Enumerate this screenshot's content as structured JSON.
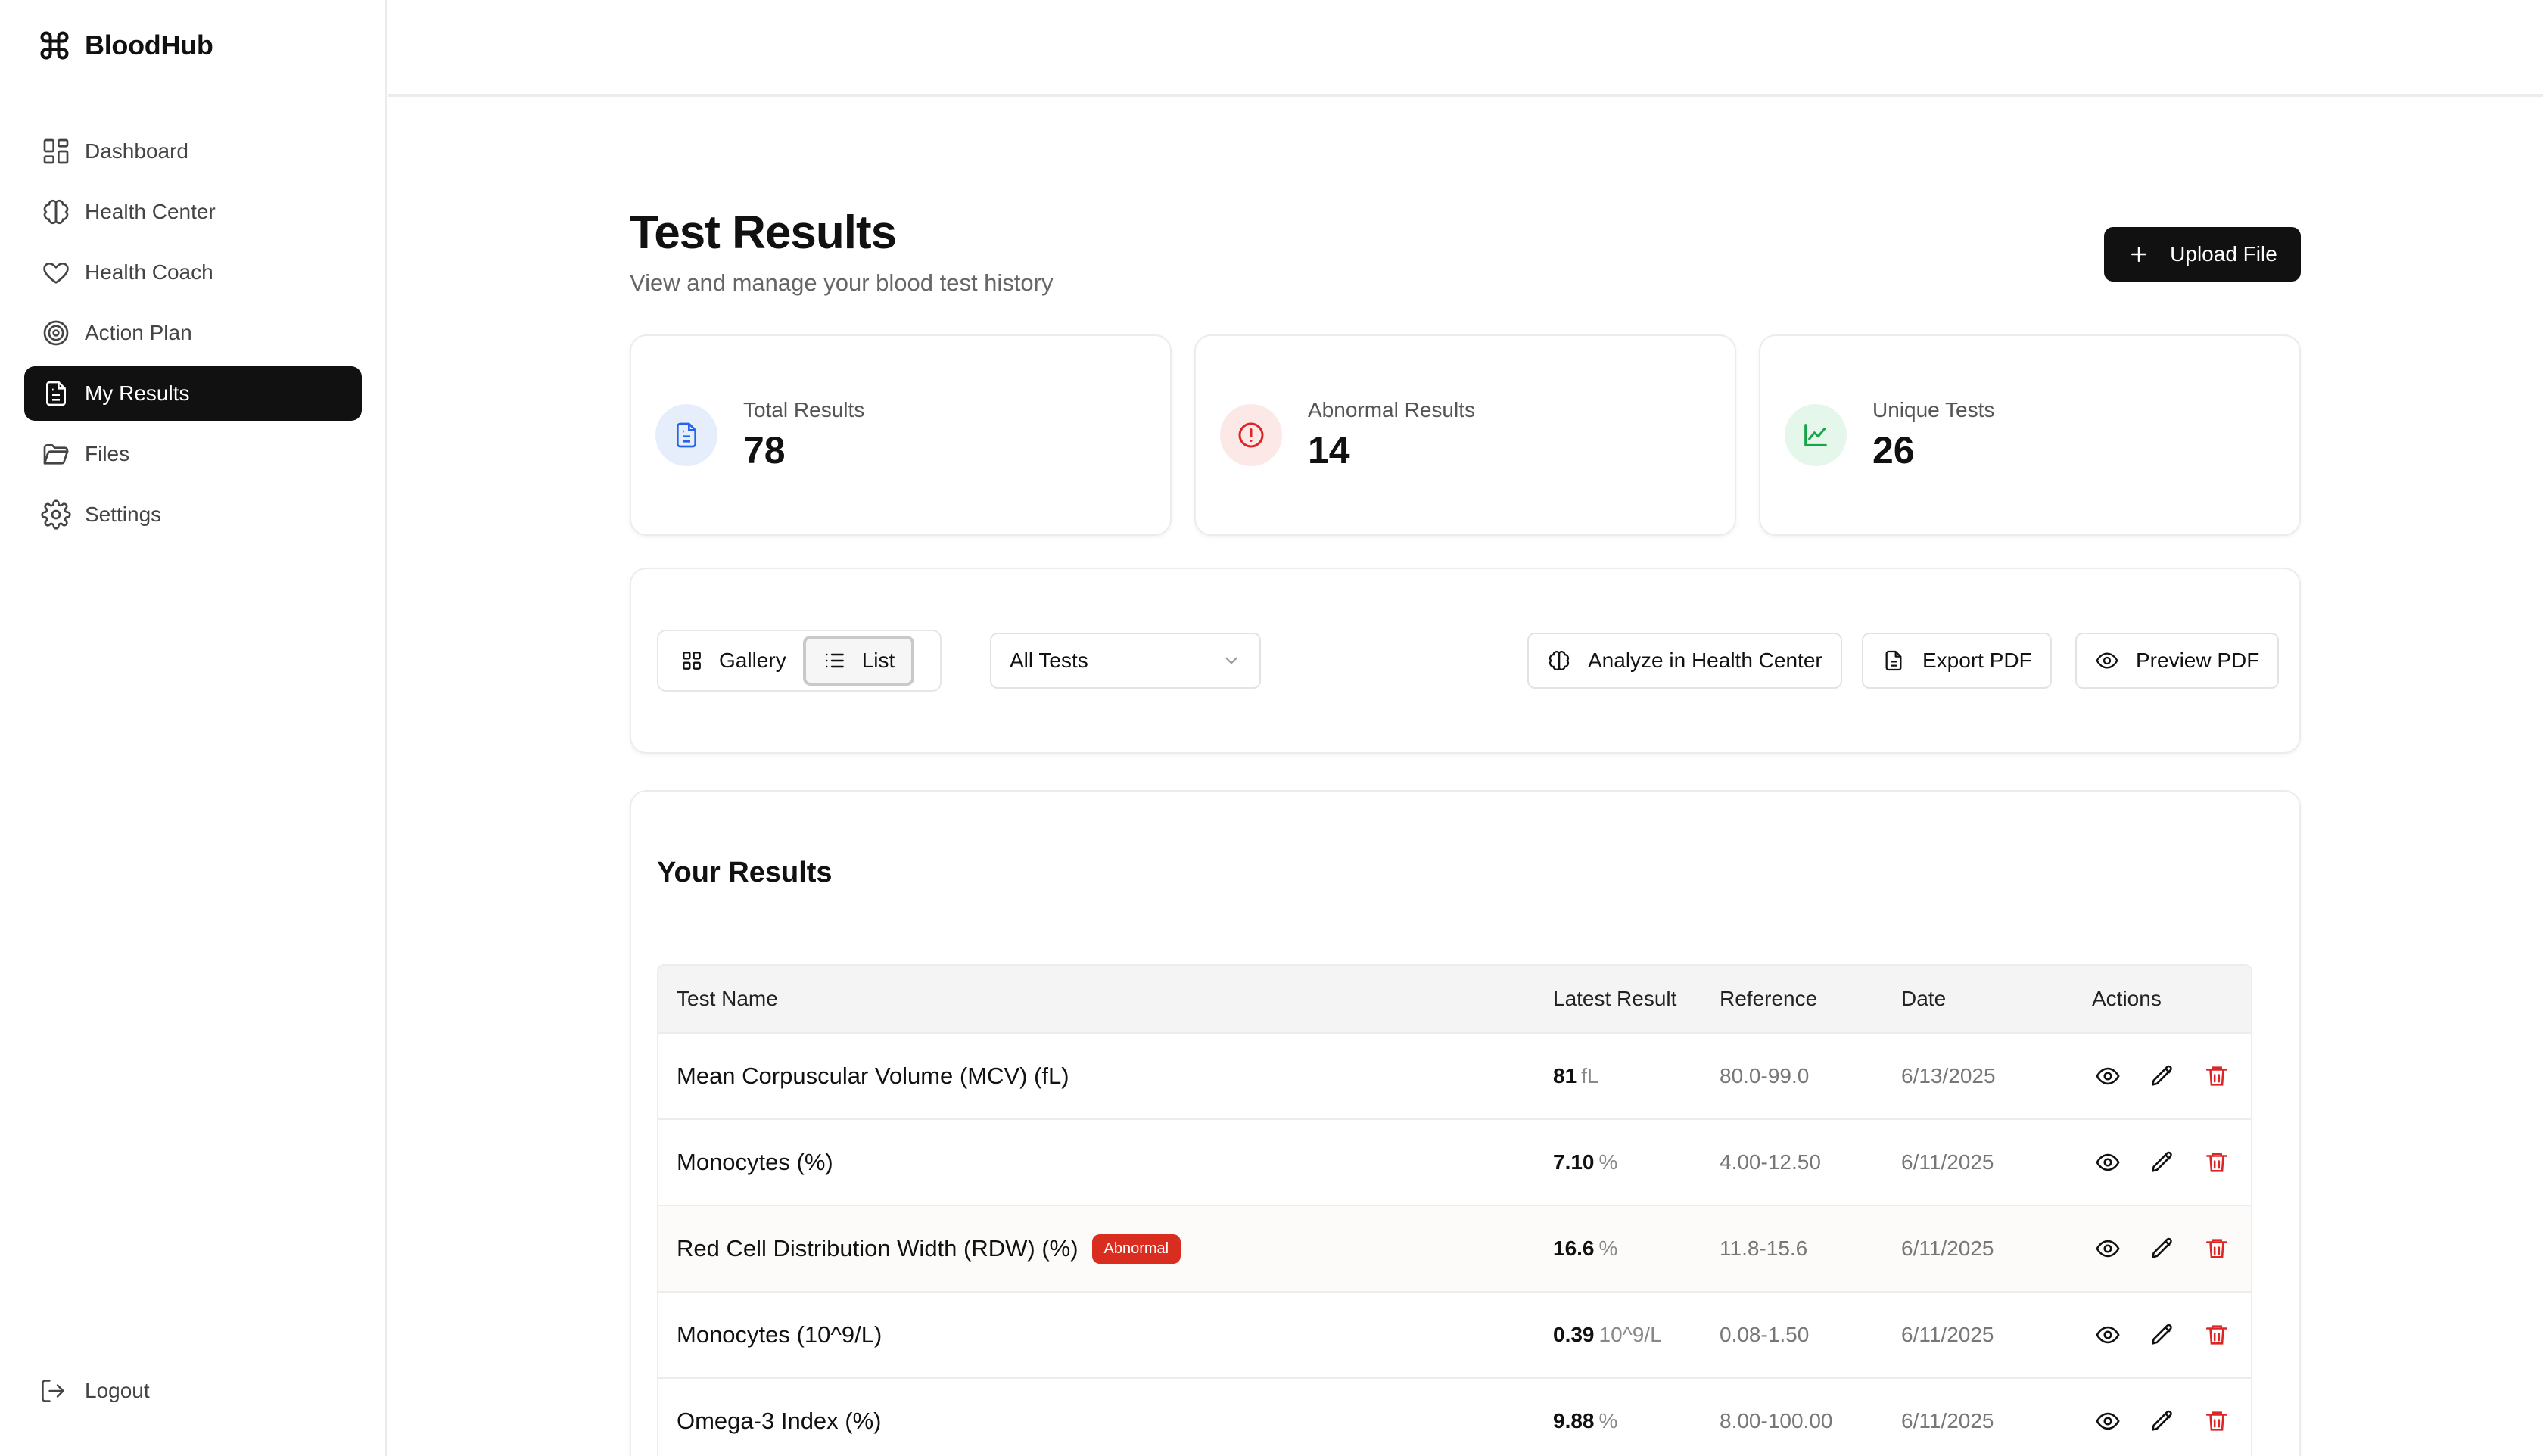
{
  "app": {
    "name": "BloodHub"
  },
  "sidebar": {
    "items": [
      {
        "label": "Dashboard",
        "icon": "grid-icon"
      },
      {
        "label": "Health Center",
        "icon": "brain-icon"
      },
      {
        "label": "Health Coach",
        "icon": "heart-icon"
      },
      {
        "label": "Action Plan",
        "icon": "target-icon"
      },
      {
        "label": "My Results",
        "icon": "document-icon",
        "active": true
      },
      {
        "label": "Files",
        "icon": "folder-icon"
      },
      {
        "label": "Settings",
        "icon": "gear-icon"
      }
    ],
    "logout": "Logout"
  },
  "header": {
    "title": "Test Results",
    "subtitle": "View and manage your blood test history",
    "upload_label": "Upload File"
  },
  "stats": [
    {
      "label": "Total Results",
      "value": "78",
      "color": "#2563eb",
      "bg": "#e6eefc"
    },
    {
      "label": "Abnormal Results",
      "value": "14",
      "color": "#dc2626",
      "bg": "#fde8e8"
    },
    {
      "label": "Unique Tests",
      "value": "26",
      "color": "#16a34a",
      "bg": "#e5f6ea"
    }
  ],
  "toolbar": {
    "gallery_label": "Gallery",
    "list_label": "List",
    "filter_selected": "All Tests",
    "analyze_label": "Analyze in Health Center",
    "export_label": "Export PDF",
    "preview_label": "Preview PDF"
  },
  "results": {
    "title": "Your Results",
    "columns": [
      "Test Name",
      "Latest Result",
      "Reference",
      "Date",
      "Actions"
    ],
    "rows": [
      {
        "name": "Mean Corpuscular Volume (MCV) (fL)",
        "value": "81",
        "unit": "fL",
        "reference": "80.0-99.0",
        "date": "6/13/2025",
        "badge": ""
      },
      {
        "name": "Monocytes (%)",
        "value": "7.10",
        "unit": "%",
        "reference": "4.00-12.50",
        "date": "6/11/2025",
        "badge": ""
      },
      {
        "name": "Red Cell Distribution Width (RDW) (%)",
        "value": "16.6",
        "unit": "%",
        "reference": "11.8-15.6",
        "date": "6/11/2025",
        "badge": "Abnormal"
      },
      {
        "name": "Monocytes (10^9/L)",
        "value": "0.39",
        "unit": "10^9/L",
        "reference": "0.08-1.50",
        "date": "6/11/2025",
        "badge": ""
      },
      {
        "name": "Omega-3 Index (%)",
        "value": "9.88",
        "unit": "%",
        "reference": "8.00-100.00",
        "date": "6/11/2025",
        "badge": ""
      }
    ]
  },
  "colors": {
    "accent": "#111111",
    "danger": "#dc2626"
  }
}
